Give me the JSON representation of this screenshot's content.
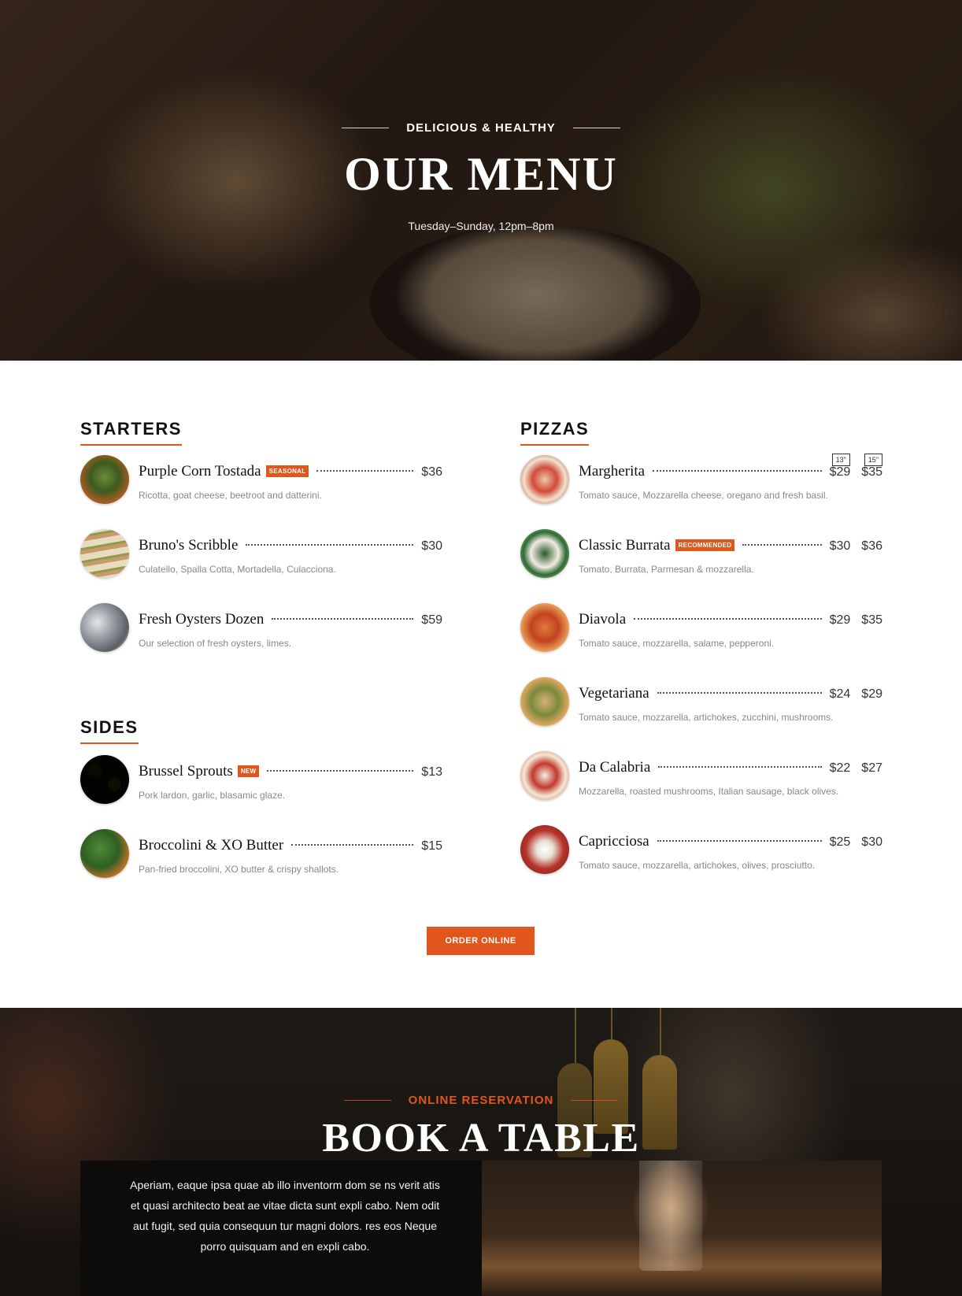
{
  "hero": {
    "eyebrow": "DELICIOUS & HEALTHY",
    "title": "OUR MENU",
    "hours": "Tuesday–Sunday, 12pm–8pm"
  },
  "menu": {
    "starters": {
      "heading": "STARTERS",
      "items": [
        {
          "name": "Purple Corn Tostada",
          "badge": "SEASONAL",
          "price": "$36",
          "desc": "Ricotta, goat cheese, beetroot and datterini."
        },
        {
          "name": "Bruno's Scribble",
          "price": "$30",
          "desc": "Culatello, Spalla Cotta, Mortadella, Culacciona."
        },
        {
          "name": "Fresh Oysters Dozen",
          "price": "$59",
          "desc": "Our selection of fresh oysters, limes."
        }
      ]
    },
    "sides": {
      "heading": "SIDES",
      "items": [
        {
          "name": "Brussel Sprouts",
          "badge": "NEW",
          "price": "$13",
          "desc": "Pork lardon, garlic, blasamic glaze."
        },
        {
          "name": "Broccolini & XO Butter",
          "price": "$15",
          "desc": "Pan-fried broccolini, XO butter & crispy shallots."
        }
      ]
    },
    "pizzas": {
      "heading": "PIZZAS",
      "sizes": [
        "13\"",
        "15\""
      ],
      "items": [
        {
          "name": "Margherita",
          "price_small": "$29",
          "price_large": "$35",
          "desc": "Tomato sauce, Mozzarella cheese, oregano and fresh basil."
        },
        {
          "name": "Classic Burrata",
          "badge": "RECOMMENDED",
          "price_small": "$30",
          "price_large": "$36",
          "desc": "Tomato, Burrata, Parmesan & mozzarella."
        },
        {
          "name": "Diavola",
          "price_small": "$29",
          "price_large": "$35",
          "desc": "Tomato sauce, mozzarella, salame, pepperoni."
        },
        {
          "name": "Vegetariana",
          "price_small": "$24",
          "price_large": "$29",
          "desc": "Tomato sauce, mozzarella, artichokes, zucchini, mushrooms."
        },
        {
          "name": "Da Calabria",
          "price_small": "$22",
          "price_large": "$27",
          "desc": "Mozzarella, roasted mushrooms, Italian sausage, black olives."
        },
        {
          "name": "Capricciosa",
          "price_small": "$25",
          "price_large": "$30",
          "desc": "Tomato sauce, mozzarella, artichokes, olives, prosciutto."
        }
      ]
    },
    "order_button": "ORDER ONLINE"
  },
  "reservation": {
    "eyebrow": "ONLINE RESERVATION",
    "title": "BOOK A TABLE",
    "text": "Aperiam, eaque ipsa quae ab illo inventorm dom se ns verit atis et quasi architecto beat ae vitae dicta sunt expli cabo. Nem odit aut fugit, sed quia consequun tur magni dolors. res eos Neque porro quisquam and en expli cabo."
  },
  "colors": {
    "accent": "#e0561c",
    "text_dark": "#111111",
    "text_muted": "#888888"
  }
}
